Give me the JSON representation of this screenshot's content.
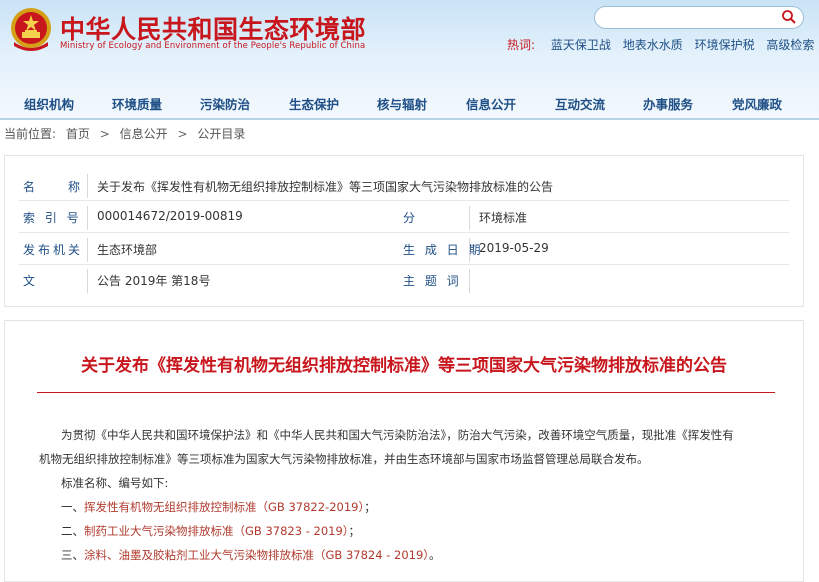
{
  "header": {
    "title_cn": "中华人民共和国生态环境部",
    "title_en": "Ministry of Ecology and Environment of the People's Republic of China",
    "search": {
      "placeholder": ""
    },
    "hot_label": "热词:",
    "hot_links": [
      "蓝天保卫战",
      "地表水水质",
      "环境保护税",
      "高级检索"
    ]
  },
  "nav": {
    "items": [
      "组织机构",
      "环境质量",
      "污染防治",
      "生态保护",
      "核与辐射",
      "信息公开",
      "互动交流",
      "办事服务",
      "党风廉政"
    ]
  },
  "breadcrumb": {
    "prefix": "当前位置:",
    "items": [
      "首页",
      "信息公开",
      "公开目录"
    ],
    "separator": ">"
  },
  "meta": {
    "name_label": "名　　称",
    "name_value": "关于发布《挥发性有机物无组织排放控制标准》等三项国家大气污染物排放标准的公告",
    "index_label": "索 引 号",
    "index_value": "000014672/2019-00819",
    "category_label": "分　　类",
    "category_value": "环境标准",
    "publisher_label": "发布机关",
    "publisher_value": "生态环境部",
    "date_label": "生 成 日 期",
    "date_value": "2019-05-29",
    "doc_no_label": "文　　号",
    "doc_no_value": "公告 2019年 第18号",
    "subject_label": "主 题 词",
    "subject_value": ""
  },
  "article": {
    "title": "关于发布《挥发性有机物无组织排放控制标准》等三项国家大气污染物排放标准的公告",
    "para1_line1": "为贯彻《中华人民共和国环境保护法》和《中华人民共和国大气污染防治法》，防治大气污染，改善环境空气质量，现批准《挥发性有",
    "para1_line2": "机物无组织排放控制标准》等三项标准为国家大气污染物排放标准，并由生态环境部与国家市场监督管理总局联合发布。",
    "para2": "标准名称、编号如下:",
    "standards": [
      {
        "prefix": "一、",
        "name": "挥发性有机物无组织排放控制标准",
        "code": "（GB 37822-2019）",
        "suffix": "；"
      },
      {
        "prefix": "二、",
        "name": "制药工业大气污染物排放标准",
        "code": "（GB 37823 - 2019）",
        "suffix": "；"
      },
      {
        "prefix": "三、",
        "name": "涂料、油墨及胶粘剂工业大气污染物排放标准",
        "code": "（GB 37824 - 2019）",
        "suffix": "。"
      }
    ]
  },
  "colors": {
    "brand_red": "#c8161d",
    "nav_blue": "#1f4f86",
    "header_bg": "#c9e3f6"
  }
}
